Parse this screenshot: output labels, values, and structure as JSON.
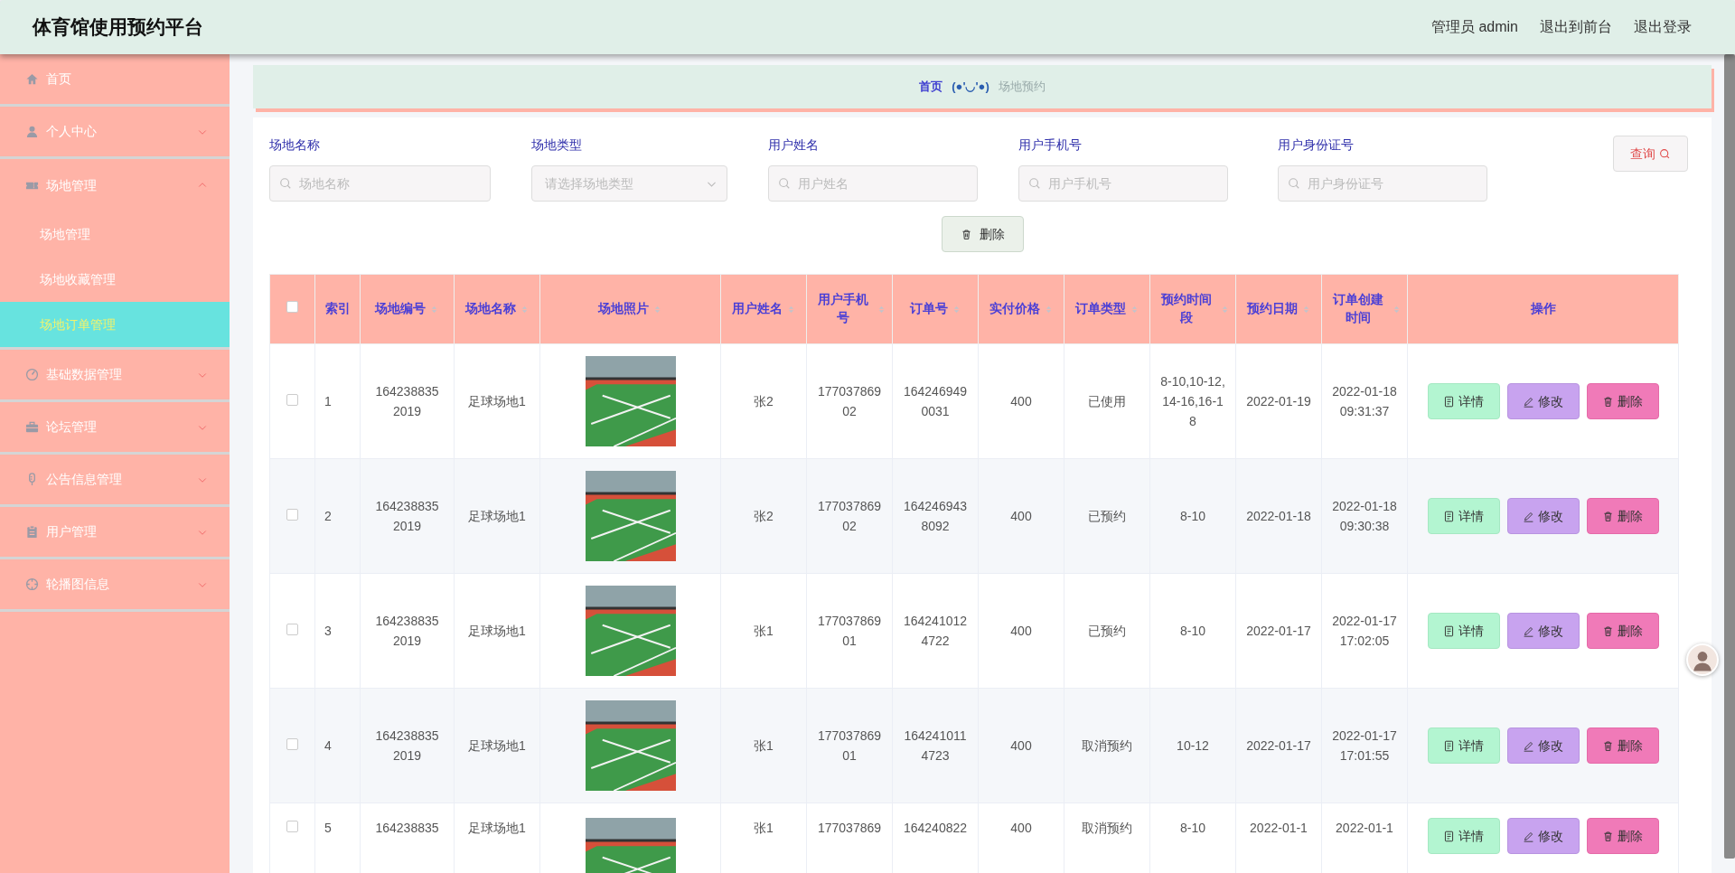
{
  "header": {
    "title": "体育馆使用预约平台",
    "links": [
      "管理员 admin",
      "退出到前台",
      "退出登录"
    ]
  },
  "sidebar": {
    "items": [
      {
        "label": "首页",
        "selected": false
      },
      {
        "label": "个人中心",
        "selected": false,
        "expanded": false
      },
      {
        "label": "场地管理",
        "selected": false,
        "expanded": true,
        "children": [
          {
            "label": "场地管理",
            "selected": false
          },
          {
            "label": "场地收藏管理",
            "selected": false
          },
          {
            "label": "场地订单管理",
            "selected": true
          }
        ]
      },
      {
        "label": "基础数据管理",
        "selected": false,
        "expanded": false
      },
      {
        "label": "论坛管理",
        "selected": false,
        "expanded": false
      },
      {
        "label": "公告信息管理",
        "selected": false,
        "expanded": false
      },
      {
        "label": "用户管理",
        "selected": false,
        "expanded": false
      },
      {
        "label": "轮播图信息",
        "selected": false,
        "expanded": false
      }
    ]
  },
  "breadcrumb": {
    "home": "首页",
    "separator": "(●'◡'●)",
    "current": "场地预约"
  },
  "filters": [
    {
      "label": "场地名称",
      "placeholder": "场地名称",
      "kind": "text"
    },
    {
      "label": "场地类型",
      "placeholder": "请选择场地类型",
      "kind": "select"
    },
    {
      "label": "用户姓名",
      "placeholder": "用户姓名",
      "kind": "text"
    },
    {
      "label": "用户手机号",
      "placeholder": "用户手机号",
      "kind": "text"
    },
    {
      "label": "用户身份证号",
      "placeholder": "用户身份证号",
      "kind": "text"
    }
  ],
  "search_button": "查询",
  "delete_button": "删除",
  "table": {
    "select_all": false,
    "columns": [
      {
        "label": "索引",
        "sortable": false
      },
      {
        "label": "场地编号",
        "sortable": true
      },
      {
        "label": "场地名称",
        "sortable": true
      },
      {
        "label": "场地照片",
        "sortable": true
      },
      {
        "label": "用户姓名",
        "sortable": true
      },
      {
        "label": "用户手机号",
        "sortable": true
      },
      {
        "label": "订单号",
        "sortable": true
      },
      {
        "label": "实付价格",
        "sortable": true
      },
      {
        "label": "订单类型",
        "sortable": true
      },
      {
        "label": "预约时间段",
        "sortable": true
      },
      {
        "label": "预约日期",
        "sortable": true
      },
      {
        "label": "订单创建时间",
        "sortable": true
      },
      {
        "label": "操作",
        "sortable": false
      }
    ],
    "rows": [
      {
        "selected": false,
        "cells": [
          "1",
          "1642388352019",
          "足球场地1",
          null,
          "张2",
          "17703786902",
          "1642469490031",
          "400",
          "已使用",
          "8-10,10-12,14-16,16-18",
          "2022-01-19",
          "2022-01-18 09:31:37"
        ],
        "actions": [
          "详情",
          "修改",
          "删除"
        ]
      },
      {
        "selected": false,
        "cells": [
          "2",
          "1642388352019",
          "足球场地1",
          null,
          "张2",
          "17703786902",
          "1642469438092",
          "400",
          "已预约",
          "8-10",
          "2022-01-18",
          "2022-01-18 09:30:38"
        ],
        "actions": [
          "详情",
          "修改",
          "删除"
        ]
      },
      {
        "selected": false,
        "cells": [
          "3",
          "1642388352019",
          "足球场地1",
          null,
          "张1",
          "17703786901",
          "1642410124722",
          "400",
          "已预约",
          "8-10",
          "2022-01-17",
          "2022-01-17 17:02:05"
        ],
        "actions": [
          "详情",
          "修改",
          "删除"
        ]
      },
      {
        "selected": false,
        "cells": [
          "4",
          "1642388352019",
          "足球场地1",
          null,
          "张1",
          "17703786901",
          "1642410114723",
          "400",
          "取消预约",
          "10-12",
          "2022-01-17",
          "2022-01-17 17:01:55"
        ],
        "actions": [
          "详情",
          "修改",
          "删除"
        ]
      },
      {
        "selected": false,
        "cells": [
          "5",
          "164238835",
          "足球场地1",
          null,
          "张1",
          "177037869",
          "164240822",
          "400",
          "取消预约",
          "8-10",
          "2022-01-1",
          "2022-01-1"
        ],
        "actions": [
          "详情",
          "修改",
          "删除"
        ]
      }
    ]
  }
}
